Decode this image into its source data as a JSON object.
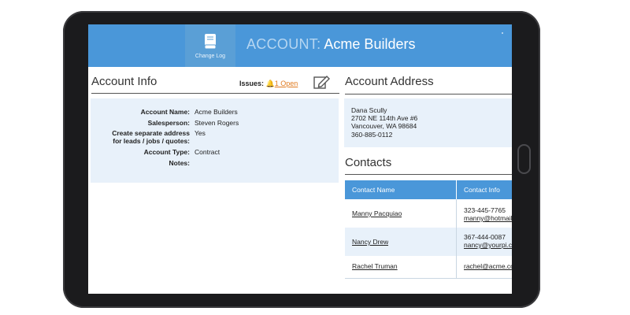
{
  "header": {
    "changelog_label": "Change Log",
    "account_prefix": "ACCOUNT:",
    "account_name": "Acme Builders"
  },
  "account_info": {
    "title": "Account Info",
    "issues_label": "Issues:",
    "issues_link": "1 Open",
    "fields": [
      {
        "label": "Account Name:",
        "value": "Acme Builders"
      },
      {
        "label": "Salesperson:",
        "value": "Steven Rogers"
      },
      {
        "label_line1": "Create separate address",
        "label_line2": "for leads / jobs / quotes:",
        "value": "Yes"
      },
      {
        "label": "Account Type:",
        "value": "Contract"
      },
      {
        "label": "Notes:",
        "value": ""
      }
    ]
  },
  "account_address": {
    "title": "Account Address",
    "lines": [
      "Dana Scully",
      "2702 NE 114th Ave #6",
      "Vancouver, WA 98684",
      "360-885-0112"
    ]
  },
  "contacts": {
    "title": "Contacts",
    "columns": [
      "Contact Name",
      "Contact Info"
    ],
    "rows": [
      {
        "name": "Manny Pacquiao",
        "phone": "323-445-7765",
        "email": "manny@hotmail.com"
      },
      {
        "name": "Nancy Drew",
        "phone": "367-444-0087",
        "email": "nancy@yourpi.com"
      },
      {
        "name": "Rachel Truman",
        "phone": "",
        "email": "rachel@acme.com"
      }
    ]
  },
  "colors": {
    "header_blue": "#4a97d9",
    "panel_bg": "#e8f1fa",
    "issue_orange": "#e07a1f",
    "icons": [
      "book-icon",
      "bell-icon",
      "edit-icon"
    ]
  }
}
